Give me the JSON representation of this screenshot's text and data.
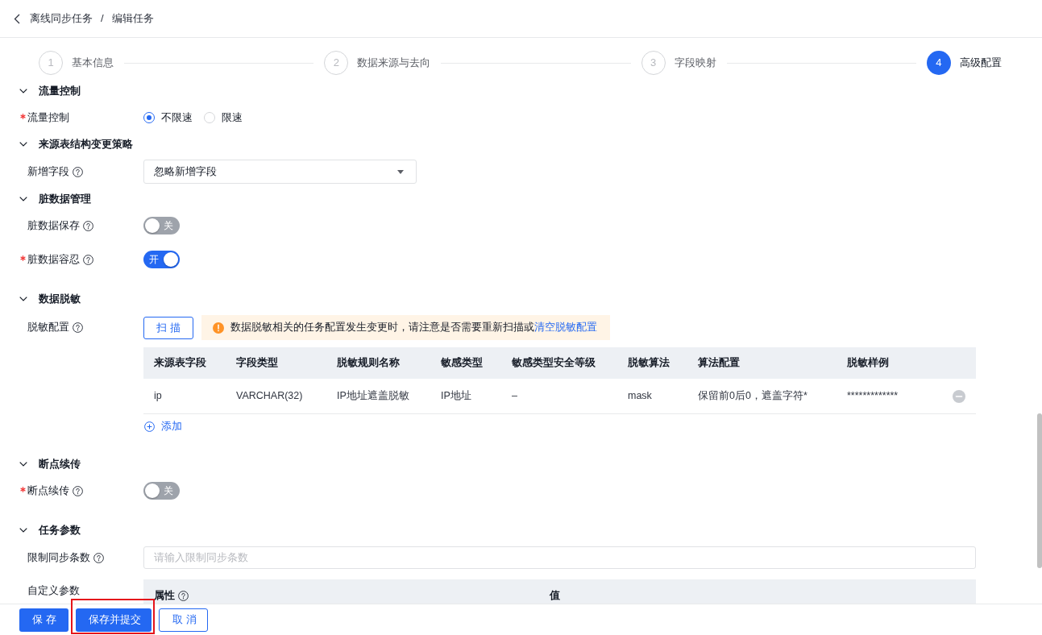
{
  "breadcrumb": {
    "items": [
      "离线同步任务",
      "编辑任务"
    ],
    "separator": "/"
  },
  "steps": [
    {
      "number": "1",
      "label": "基本信息",
      "selected": false
    },
    {
      "number": "2",
      "label": "数据来源与去向",
      "selected": false
    },
    {
      "number": "3",
      "label": "字段映射",
      "selected": false
    },
    {
      "number": "4",
      "label": "高级配置",
      "selected": true
    }
  ],
  "sections": [
    {
      "title": "流量控制",
      "expanded": true,
      "fields": [
        {
          "kind": "radio",
          "label": "流量控制",
          "required": true,
          "help": false,
          "options": [
            {
              "label": "不限速",
              "selected": true
            },
            {
              "label": "限速",
              "selected": false
            }
          ]
        }
      ]
    },
    {
      "title": "来源表结构变更策略",
      "expanded": true,
      "fields": [
        {
          "kind": "select",
          "label": "新增字段",
          "required": false,
          "help": true,
          "value": "忽略新增字段"
        }
      ]
    },
    {
      "title": "脏数据管理",
      "expanded": true,
      "fields": [
        {
          "kind": "switch",
          "label": "脏数据保存",
          "required": false,
          "help": true,
          "on": false,
          "text": "关"
        },
        {
          "kind": "switch",
          "label": "脏数据容忍",
          "required": true,
          "help": true,
          "on": true,
          "text": "开"
        }
      ]
    },
    {
      "title": "数据脱敏",
      "expanded": true,
      "fields": [
        {
          "kind": "masking",
          "label": "脱敏配置",
          "required": false,
          "help": true,
          "button": "扫 描",
          "alert": {
            "text": "数据脱敏相关的任务配置发生变更时，请注意是否需要重新扫描或",
            "link": "清空脱敏配置"
          },
          "columns": [
            "来源表字段",
            "字段类型",
            "脱敏规则名称",
            "敏感类型",
            "敏感类型安全等级",
            "脱敏算法",
            "算法配置",
            "脱敏样例"
          ],
          "rows": [
            [
              "ip",
              "VARCHAR(32)",
              "IP地址遮盖脱敏",
              "IP地址",
              "–",
              "mask",
              "保留前0后0，遮盖字符*",
              "*************"
            ]
          ],
          "add_label": "添加"
        }
      ]
    },
    {
      "title": "断点续传",
      "expanded": true,
      "fields": [
        {
          "kind": "switch",
          "label": "断点续传",
          "required": true,
          "help": true,
          "on": false,
          "text": "关"
        }
      ]
    },
    {
      "title": "任务参数",
      "expanded": true,
      "fields": [
        {
          "kind": "input",
          "label": "限制同步条数",
          "required": false,
          "help": true,
          "placeholder": "请输入限制同步条数"
        },
        {
          "kind": "kv_table",
          "label": "自定义参数",
          "required": false,
          "help": false,
          "columns": [
            {
              "label": "属性",
              "help": true
            },
            {
              "label": "值",
              "help": false
            }
          ]
        }
      ]
    }
  ],
  "footer": {
    "buttons": [
      {
        "label": "保 存",
        "kind": "primary",
        "highlighted": false
      },
      {
        "label": "保存并提交",
        "kind": "primary",
        "highlighted": true
      },
      {
        "label": "取 消",
        "kind": "default",
        "highlighted": false
      }
    ]
  }
}
